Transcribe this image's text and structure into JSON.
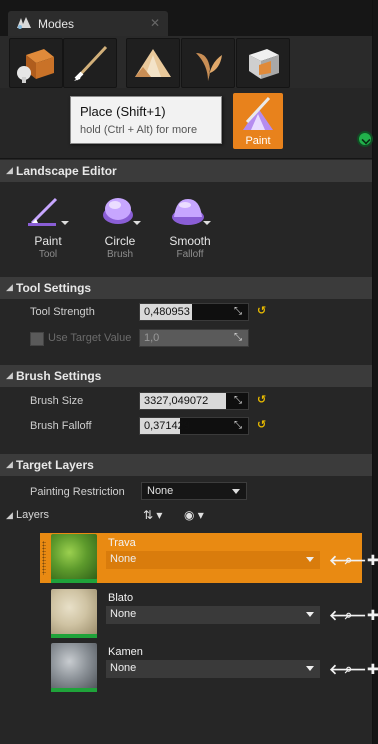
{
  "window": {
    "tab_title": "Modes"
  },
  "modes": {
    "buttons": [
      "place-mode-icon",
      "paint-brush-mode-icon",
      "landscape-mode-icon",
      "foliage-mode-icon",
      "geometry-mode-icon"
    ]
  },
  "tooltip": {
    "title": "Place (Shift+1)",
    "hint": "hold (Ctrl + Alt) for more"
  },
  "active_mode": {
    "label": "Paint"
  },
  "sections": {
    "landscape_editor": "Landscape Editor",
    "tool_settings": "Tool Settings",
    "brush_settings": "Brush Settings",
    "target_layers": "Target Layers"
  },
  "tools": [
    {
      "name": "Paint",
      "sub": "Tool"
    },
    {
      "name": "Circle",
      "sub": "Brush"
    },
    {
      "name": "Smooth",
      "sub": "Falloff"
    }
  ],
  "tool_settings": {
    "strength_label": "Tool Strength",
    "strength_value": "0,480953",
    "strength_fraction": 0.48,
    "target_label": "Use Target Value",
    "target_value": "1,0",
    "target_checked": false
  },
  "brush_settings": {
    "size_label": "Brush Size",
    "size_value": "3327,049072",
    "falloff_label": "Brush Falloff",
    "falloff_value": "0,371429",
    "falloff_fraction": 0.37
  },
  "target_layers": {
    "restriction_label": "Painting Restriction",
    "restriction_value": "None",
    "layers_label": "Layers",
    "layers": [
      {
        "name": "Trava",
        "value": "None",
        "selected": true
      },
      {
        "name": "Blato",
        "value": "None",
        "selected": false
      },
      {
        "name": "Kamen",
        "value": "None",
        "selected": false
      }
    ]
  },
  "colors": {
    "accent": "#e98a12",
    "reset": "#e6b800",
    "badge": "#21b24b"
  }
}
